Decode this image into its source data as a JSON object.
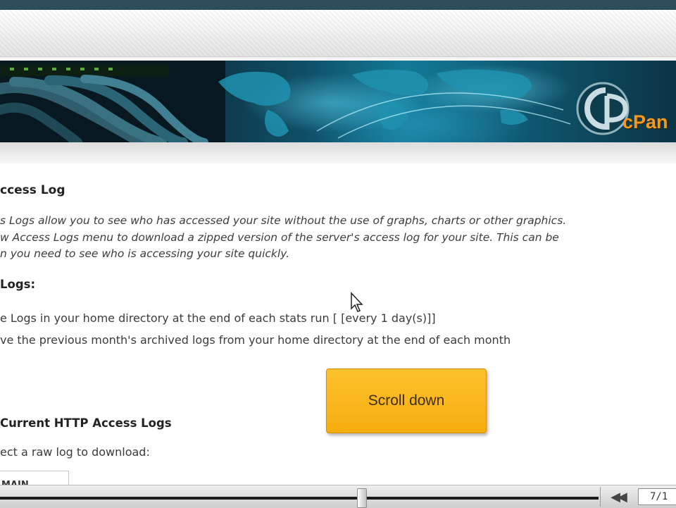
{
  "banner": {
    "brand_text": "cPan"
  },
  "content": {
    "heading": "ccess Log",
    "description_lines": [
      "s Logs allow you to see who has accessed your site without the use of graphs, charts or other graphics.",
      "w Access Logs menu to download a zipped version of the server's access log for your site. This can be",
      "n you need to see who is accessing your site quickly."
    ],
    "logs_heading": "Logs:",
    "options": [
      "e Logs in your home directory at the end of each stats run [ [every 1 day(s)]]",
      "ve the previous month's archived logs from your home directory at the end of each month"
    ],
    "current_heading": "Current HTTP Access Logs",
    "select_prompt": "ect a raw log to download:",
    "select_value": "MAIN"
  },
  "overlay": {
    "callout_label": "Scroll down"
  },
  "player": {
    "rewind_glyph": "◀◀",
    "counter": "7/1"
  },
  "colors": {
    "callout": "#f9b61e",
    "brand": "#f29a1d",
    "banner_teal": "#137a96"
  }
}
